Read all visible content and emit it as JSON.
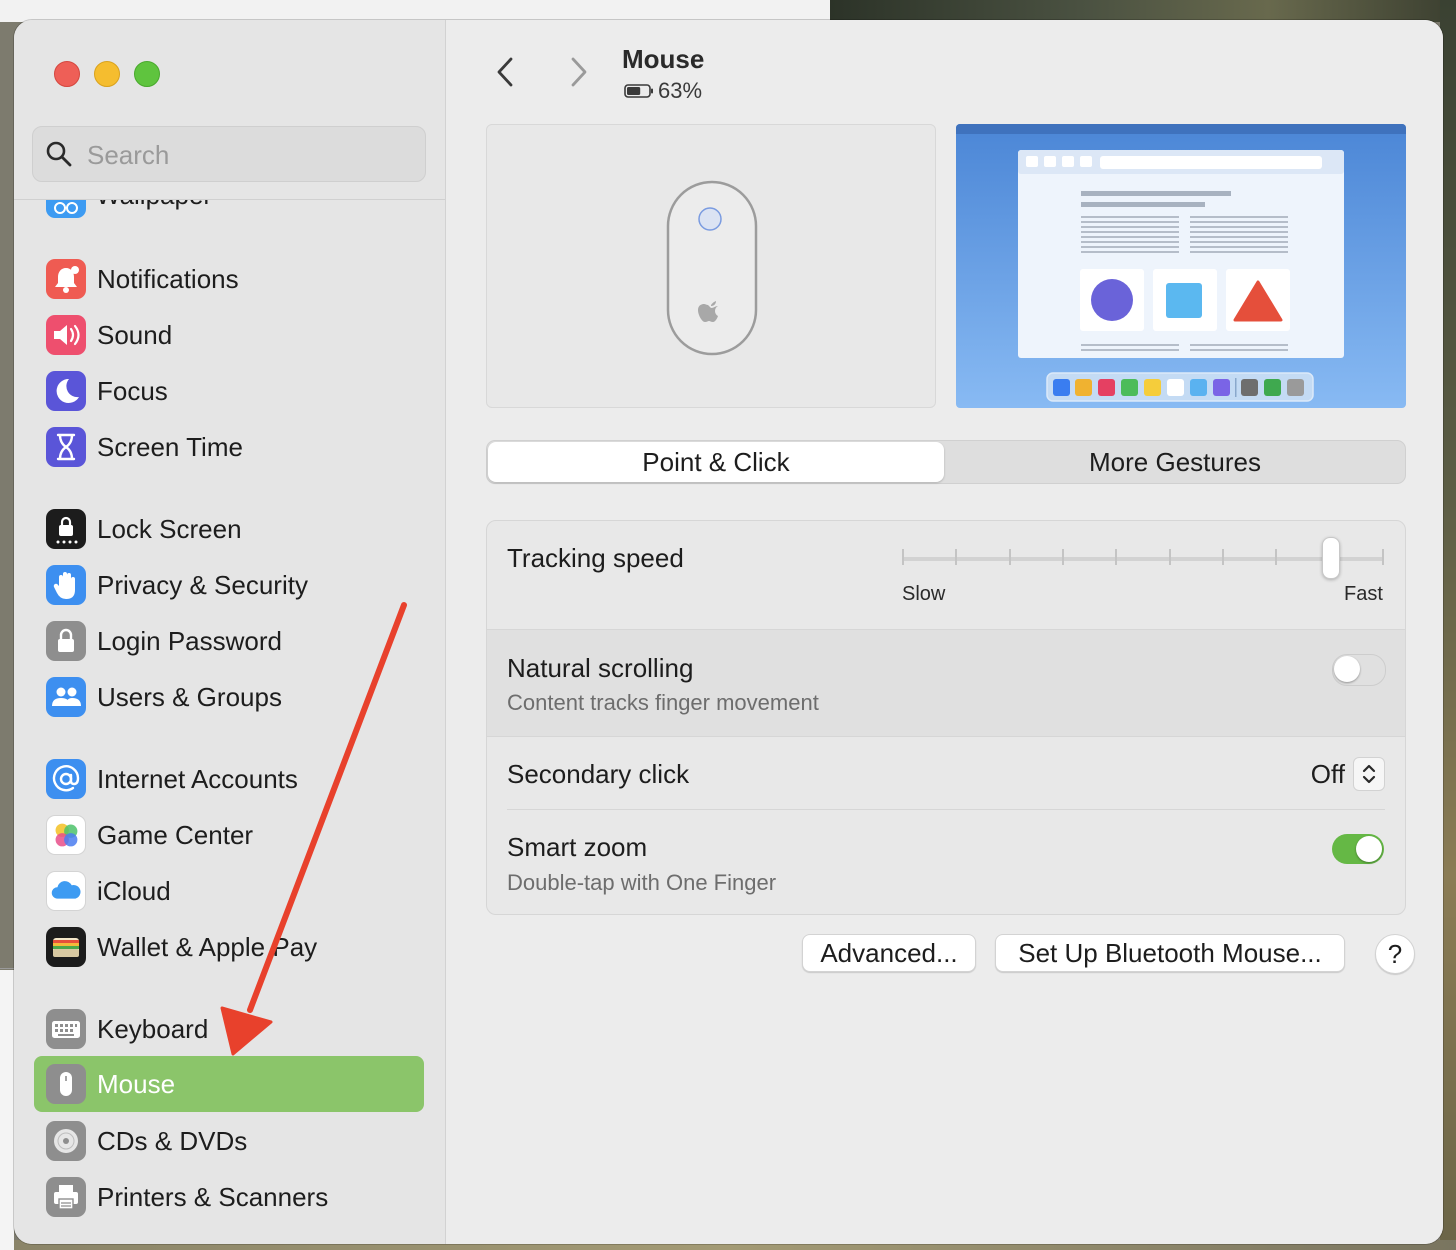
{
  "window": {
    "traffic_lights": [
      "close",
      "minimize",
      "zoom"
    ]
  },
  "search": {
    "placeholder": "Search"
  },
  "sidebar": {
    "clipped_item": "Wallpaper",
    "items": [
      {
        "label": "Notifications",
        "icon": "bell-icon",
        "color": "#ef5b52"
      },
      {
        "label": "Sound",
        "icon": "speaker-icon",
        "color": "#ee4f6e"
      },
      {
        "label": "Focus",
        "icon": "moon-icon",
        "color": "#5a55d8"
      },
      {
        "label": "Screen Time",
        "icon": "hourglass-icon",
        "color": "#5a55d8"
      },
      {
        "label": "Lock Screen",
        "icon": "lock-screen-icon",
        "color": "#1c1c1c"
      },
      {
        "label": "Privacy & Security",
        "icon": "hand-icon",
        "color": "#3d8ff0"
      },
      {
        "label": "Login Password",
        "icon": "padlock-icon",
        "color": "#8e8e8e"
      },
      {
        "label": "Users & Groups",
        "icon": "users-icon",
        "color": "#3d8ff0"
      },
      {
        "label": "Internet Accounts",
        "icon": "at-icon",
        "color": "#3d8ff0"
      },
      {
        "label": "Game Center",
        "icon": "game-center-icon",
        "color": "#ffffff"
      },
      {
        "label": "iCloud",
        "icon": "cloud-icon",
        "color": "#ffffff"
      },
      {
        "label": "Wallet & Apple Pay",
        "icon": "wallet-icon",
        "color": "#1c1c1c"
      },
      {
        "label": "Keyboard",
        "icon": "keyboard-icon",
        "color": "#8e8e8e"
      },
      {
        "label": "Mouse",
        "icon": "mouse-icon",
        "color": "#8e8e8e",
        "selected": true
      },
      {
        "label": "CDs & DVDs",
        "icon": "disc-icon",
        "color": "#8e8e8e"
      },
      {
        "label": "Printers & Scanners",
        "icon": "printer-icon",
        "color": "#8e8e8e"
      }
    ]
  },
  "header": {
    "title": "Mouse",
    "battery": "63%",
    "battery_level": 0.63
  },
  "tabs": [
    {
      "label": "Point & Click",
      "active": true
    },
    {
      "label": "More Gestures",
      "active": false
    }
  ],
  "settings": {
    "tracking_speed": {
      "label": "Tracking speed",
      "min_label": "Slow",
      "max_label": "Fast",
      "ticks": 10,
      "value_step": 8
    },
    "natural_scrolling": {
      "label": "Natural scrolling",
      "description": "Content tracks finger movement",
      "enabled": false
    },
    "secondary_click": {
      "label": "Secondary click",
      "value": "Off"
    },
    "smart_zoom": {
      "label": "Smart zoom",
      "description": "Double-tap with One Finger",
      "enabled": true
    }
  },
  "buttons": {
    "advanced": "Advanced...",
    "bluetooth": "Set Up Bluetooth Mouse...",
    "help": "?"
  },
  "colors": {
    "selection": "#8bc56a",
    "toggle_on": "#65b845",
    "annotation_arrow": "#e8412c"
  }
}
